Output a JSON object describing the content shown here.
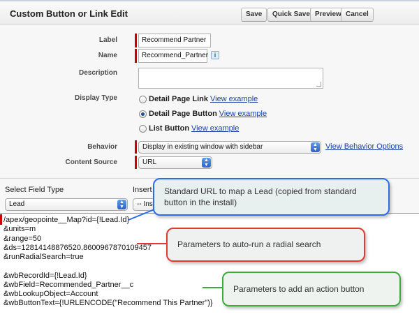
{
  "header": {
    "title": "Custom Button or Link Edit",
    "buttons": {
      "save": "Save",
      "quick_save": "Quick Save",
      "preview": "Preview",
      "cancel": "Cancel"
    }
  },
  "form": {
    "label": {
      "label": "Label",
      "value": "Recommend Partner"
    },
    "name": {
      "label": "Name",
      "value": "Recommend_Partner",
      "info": "i"
    },
    "description": {
      "label": "Description",
      "value": ""
    },
    "display_type": {
      "label": "Display Type",
      "options": [
        {
          "label": "Detail Page Link",
          "example": "View example",
          "selected": false
        },
        {
          "label": "Detail Page Button",
          "example": "View example",
          "selected": true
        },
        {
          "label": "List Button",
          "example": "View example",
          "selected": false
        }
      ]
    },
    "behavior": {
      "label": "Behavior",
      "value": "Display in existing window with sidebar",
      "options_link": "View Behavior Options"
    },
    "content_source": {
      "label": "Content Source",
      "value": "URL"
    }
  },
  "field_type": {
    "label": "Select Field Type",
    "value": "Lead",
    "insert_label": "Insert F",
    "insert_value": "-- Ins"
  },
  "code": {
    "lines": [
      "/apex/geopointe__Map?id={!Lead.Id}",
      "",
      "&units=m",
      "&range=50",
      "&ds=12814148876520.8600967870109457",
      "&runRadialSearch=true",
      "",
      "&wbRecordId={!Lead.Id}",
      "&wbField=Recommended_Partner__c",
      "&wbLookupObject=Account",
      "&wbButtonText={!URLENCODE(\"Recommend This Partner\")}"
    ]
  },
  "callouts": {
    "blue": "Standard URL to map a Lead (copied from standard button in the install)",
    "red": "Parameters to auto-run a radial search",
    "green": "Parameters to add an action button"
  },
  "colors": {
    "blue": "#2b6de8",
    "red": "#e03a32",
    "green": "#3cab3c",
    "required": "#cc0000",
    "link": "#1a3fa6"
  }
}
